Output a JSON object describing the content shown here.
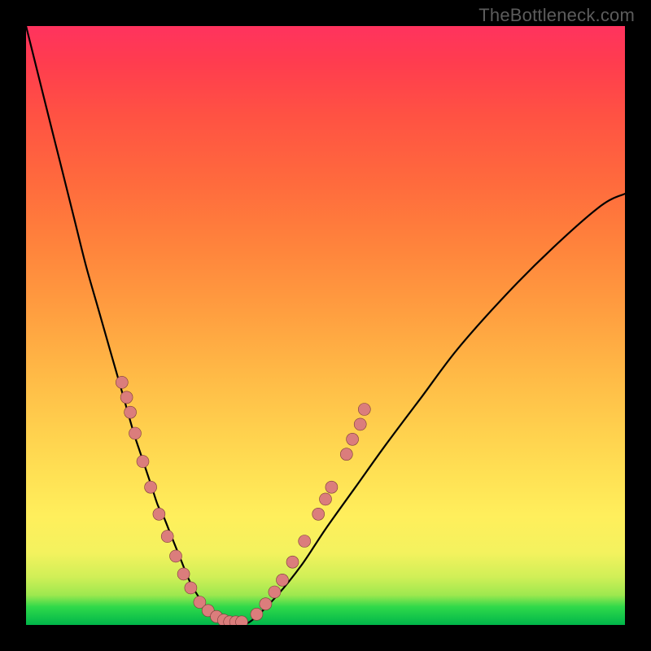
{
  "watermark": "TheBottleneck.com",
  "chart_data": {
    "type": "line",
    "title": "",
    "xlabel": "",
    "ylabel": "",
    "xlim": [
      0,
      100
    ],
    "ylim": [
      0,
      100
    ],
    "grid": false,
    "series": [
      {
        "name": "bottleneck-curve",
        "x": [
          0,
          2,
          4,
          6,
          8,
          10,
          12,
          14,
          16,
          18,
          19,
          20,
          21,
          22,
          23,
          24,
          25,
          26,
          27,
          28,
          30,
          32,
          34,
          36,
          38,
          42,
          46,
          50,
          55,
          60,
          66,
          72,
          80,
          88,
          96,
          100
        ],
        "y": [
          100,
          92,
          84,
          76,
          68,
          60,
          53,
          46,
          39,
          32,
          29,
          26,
          23,
          20,
          18,
          15.5,
          13,
          10.5,
          8,
          6,
          3,
          1,
          0,
          0,
          1,
          5,
          10,
          16,
          23,
          30,
          38,
          46,
          55,
          63,
          70,
          72
        ]
      }
    ],
    "annotations": [
      {
        "name": "left-cluster",
        "points": [
          {
            "x": 16.0,
            "y": 40.5
          },
          {
            "x": 16.8,
            "y": 38.0
          },
          {
            "x": 17.4,
            "y": 35.5
          },
          {
            "x": 18.2,
            "y": 32.0
          },
          {
            "x": 19.5,
            "y": 27.3
          },
          {
            "x": 20.8,
            "y": 23.0
          },
          {
            "x": 22.2,
            "y": 18.5
          },
          {
            "x": 23.6,
            "y": 14.8
          },
          {
            "x": 25.0,
            "y": 11.5
          },
          {
            "x": 26.3,
            "y": 8.5
          },
          {
            "x": 27.5,
            "y": 6.2
          },
          {
            "x": 29.0,
            "y": 3.8
          },
          {
            "x": 30.4,
            "y": 2.4
          },
          {
            "x": 31.8,
            "y": 1.4
          },
          {
            "x": 33.0,
            "y": 0.8
          }
        ]
      },
      {
        "name": "valley-cluster",
        "points": [
          {
            "x": 34.0,
            "y": 0.5
          },
          {
            "x": 35.0,
            "y": 0.5
          },
          {
            "x": 36.0,
            "y": 0.5
          }
        ]
      },
      {
        "name": "right-cluster",
        "points": [
          {
            "x": 38.5,
            "y": 1.8
          },
          {
            "x": 40.0,
            "y": 3.5
          },
          {
            "x": 41.5,
            "y": 5.5
          },
          {
            "x": 42.8,
            "y": 7.5
          },
          {
            "x": 44.5,
            "y": 10.5
          },
          {
            "x": 46.5,
            "y": 14.0
          },
          {
            "x": 48.8,
            "y": 18.5
          },
          {
            "x": 50.0,
            "y": 21.0
          },
          {
            "x": 51.0,
            "y": 23.0
          },
          {
            "x": 53.5,
            "y": 28.5
          },
          {
            "x": 54.5,
            "y": 31.0
          },
          {
            "x": 55.8,
            "y": 33.5
          },
          {
            "x": 56.5,
            "y": 36.0
          }
        ]
      }
    ]
  },
  "colors": {
    "dot_fill": "#db7d7c",
    "dot_stroke": "#7a3b3a",
    "curve": "#000000",
    "frame": "#000000"
  }
}
